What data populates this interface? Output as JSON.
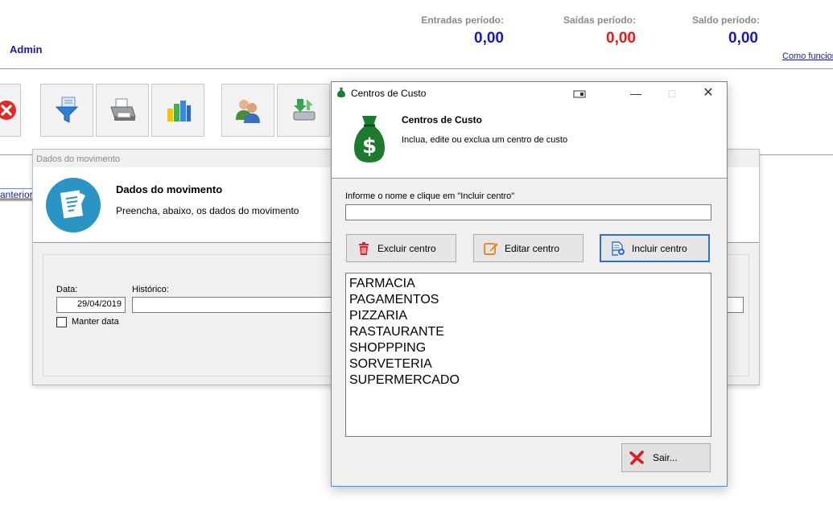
{
  "header": {
    "user": "Admin",
    "summary": [
      {
        "label": "Entradas período:",
        "value": "0,00",
        "color": "#1a1ab0"
      },
      {
        "label": "Saídas período:",
        "value": "0,00",
        "color": "#e01b1b"
      },
      {
        "label": "Saldo período:",
        "value": "0,00",
        "color": "#1a1ab0"
      }
    ],
    "help_link": "Como funcior"
  },
  "toolbar": {
    "icons": [
      "close-icon",
      "filter-icon",
      "printer-icon",
      "bar-chart-icon",
      "users-icon",
      "import-icon"
    ]
  },
  "main": {
    "nav_link": "anterior"
  },
  "movimento_window": {
    "caption": "Dados do movimento",
    "title": "Dados do movimento",
    "subtitle": "Preencha, abaixo, os dados do movimento",
    "data_label": "Data:",
    "data_value": "29/04/2019",
    "historico_label": "Histórico:",
    "historico_value": "",
    "manter_data_label": "Manter data",
    "manter_data_checked": false
  },
  "centros_dialog": {
    "window_title": "Centros de Custo",
    "title": "Centros de Custo",
    "subtitle": "Inclua, edite ou exclua um centro de custo",
    "prompt": "Informe o nome e clique em \"Incluir centro\"",
    "name_value": "",
    "buttons": {
      "excluir": "Excluir centro",
      "editar": "Editar centro",
      "incluir": "Incluir centro",
      "sair": "Sair..."
    },
    "items": [
      "FARMACIA",
      "PAGAMENTOS",
      "PIZZARIA",
      "RASTAURANTE",
      "SHOPPPING",
      "SORVETERIA",
      "SUPERMERCADO"
    ],
    "colors": {
      "accent": "#2f6fd1",
      "money_bag": "#1e7a2e",
      "delete_red": "#d62828",
      "edit_orange": "#e8892b"
    }
  }
}
